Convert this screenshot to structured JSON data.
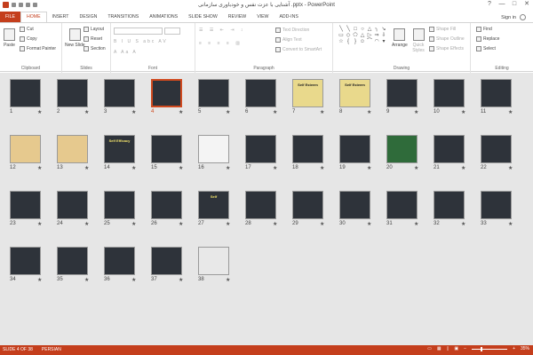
{
  "window": {
    "title": "آشنایی با عزت نفس و خودباوری سازمانی .pptx - PowerPoint",
    "controls": [
      "?",
      "—",
      "□",
      "✕"
    ]
  },
  "tabs": [
    "FILE",
    "HOME",
    "INSERT",
    "DESIGN",
    "TRANSITIONS",
    "ANIMATIONS",
    "SLIDE SHOW",
    "REVIEW",
    "VIEW",
    "ADD-INS"
  ],
  "signin": "Sign in",
  "ribbon": {
    "clipboard": {
      "label": "Clipboard",
      "paste": "Paste",
      "cut": "Cut",
      "copy": "Copy",
      "format_painter": "Format Painter"
    },
    "slides": {
      "label": "Slides",
      "new_slide": "New Slide",
      "layout": "Layout",
      "reset": "Reset",
      "section": "Section"
    },
    "font": {
      "label": "Font"
    },
    "paragraph": {
      "label": "Paragraph",
      "text_direction": "Text Direction",
      "align_text": "Align Text",
      "convert_smartart": "Convert to SmartArt"
    },
    "drawing": {
      "label": "Drawing",
      "arrange": "Arrange",
      "quick_styles": "Quick Styles",
      "shape_fill": "Shape Fill",
      "shape_outline": "Shape Outline",
      "shape_effects": "Shape Effects"
    },
    "editing": {
      "label": "Editing",
      "find": "Find",
      "replace": "Replace",
      "select": "Select"
    }
  },
  "slides": [
    {
      "n": "1",
      "bg": "#2e333a"
    },
    {
      "n": "2",
      "bg": "#2e333a"
    },
    {
      "n": "3",
      "bg": "#2e333a"
    },
    {
      "n": "4",
      "bg": "#2e333a",
      "selected": true
    },
    {
      "n": "5",
      "bg": "#2e333a"
    },
    {
      "n": "6",
      "bg": "#2e333a"
    },
    {
      "n": "7",
      "bg": "#e9d98c"
    },
    {
      "n": "8",
      "bg": "#e9d98c"
    },
    {
      "n": "9",
      "bg": "#2e333a"
    },
    {
      "n": "10",
      "bg": "#2e333a"
    },
    {
      "n": "11",
      "bg": "#2e333a"
    },
    {
      "n": "12",
      "bg": "#e6c98e"
    },
    {
      "n": "13",
      "bg": "#e6c98e"
    },
    {
      "n": "14",
      "bg": "#2e333a"
    },
    {
      "n": "15",
      "bg": "#2e333a"
    },
    {
      "n": "16",
      "bg": "#f4f4f4"
    },
    {
      "n": "17",
      "bg": "#2e333a"
    },
    {
      "n": "18",
      "bg": "#2e333a"
    },
    {
      "n": "19",
      "bg": "#2e333a"
    },
    {
      "n": "20",
      "bg": "#2f6b3a"
    },
    {
      "n": "21",
      "bg": "#2e333a"
    },
    {
      "n": "22",
      "bg": "#2e333a"
    },
    {
      "n": "23",
      "bg": "#2e333a"
    },
    {
      "n": "24",
      "bg": "#2e333a"
    },
    {
      "n": "25",
      "bg": "#2e333a"
    },
    {
      "n": "26",
      "bg": "#2e333a"
    },
    {
      "n": "27",
      "bg": "#2e333a"
    },
    {
      "n": "28",
      "bg": "#2e333a"
    },
    {
      "n": "29",
      "bg": "#2e333a"
    },
    {
      "n": "30",
      "bg": "#2e333a"
    },
    {
      "n": "31",
      "bg": "#2e333a"
    },
    {
      "n": "32",
      "bg": "#2e333a"
    },
    {
      "n": "33",
      "bg": "#2e333a"
    },
    {
      "n": "34",
      "bg": "#2e333a"
    },
    {
      "n": "35",
      "bg": "#2e333a"
    },
    {
      "n": "36",
      "bg": "#2e333a"
    },
    {
      "n": "37",
      "bg": "#2e333a"
    },
    {
      "n": "38",
      "bg": "#e8e8e8"
    }
  ],
  "slide_texts": {
    "s7": "Self Esteem",
    "s8": "Self Esteem",
    "s14": "Self Efficacy",
    "s27": "Self"
  },
  "status": {
    "slide_info": "SLIDE 4 OF 38",
    "language": "PERSIAN",
    "zoom": "35%"
  },
  "colors": {
    "accent": "#c43e1c",
    "sorter_bg": "#e6e6e6",
    "selection": "#d04a1f"
  }
}
